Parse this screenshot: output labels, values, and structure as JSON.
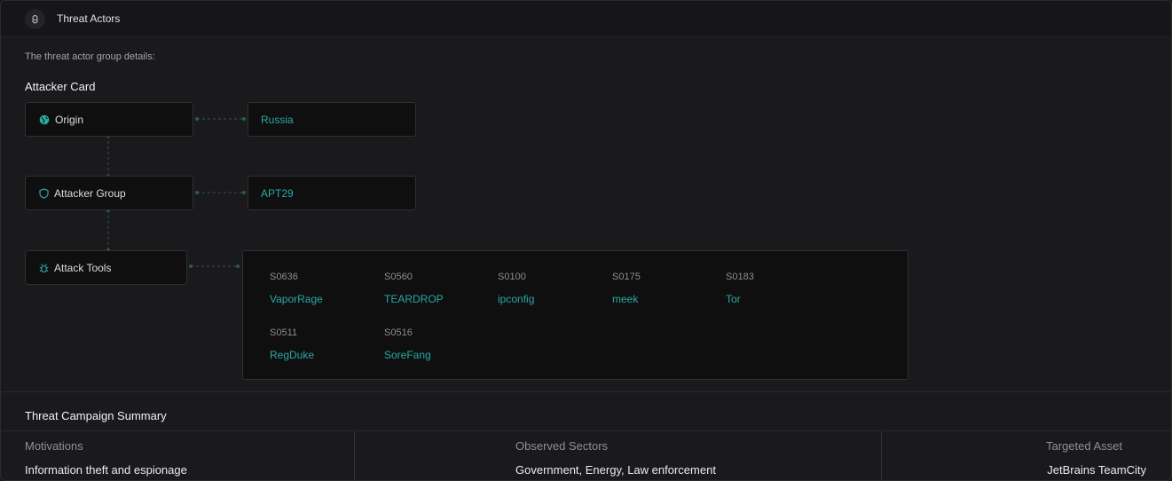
{
  "header": {
    "title": "Threat Actors",
    "icon": "user-shield-icon"
  },
  "description": "The threat actor group details:",
  "attacker_card": {
    "title": "Attacker Card",
    "origin": {
      "label": "Origin",
      "icon": "globe-icon",
      "value": "Russia"
    },
    "group": {
      "label": "Attacker Group",
      "icon": "shield-icon",
      "value": "APT29"
    },
    "tools": {
      "label": "Attack Tools",
      "icon": "bug-icon",
      "items": [
        {
          "id": "S0636",
          "name": "VaporRage"
        },
        {
          "id": "S0560",
          "name": "TEARDROP"
        },
        {
          "id": "S0100",
          "name": "ipconfig"
        },
        {
          "id": "S0175",
          "name": "meek"
        },
        {
          "id": "S0183",
          "name": "Tor"
        },
        {
          "id": "S0511",
          "name": "RegDuke"
        },
        {
          "id": "S0516",
          "name": "SoreFang"
        }
      ]
    }
  },
  "summary": {
    "title": "Threat Campaign Summary",
    "columns": [
      {
        "header": "Motivations",
        "value": "Information theft and espionage"
      },
      {
        "header": "Observed Sectors",
        "value": "Government, Energy, Law enforcement"
      },
      {
        "header": "Targeted Asset",
        "value": "JetBrains TeamCity"
      }
    ]
  },
  "colors": {
    "accent": "#2aa8a2",
    "background": "#1a1a1c",
    "box_background": "#0f0f10",
    "connector": "#2f5a4b"
  }
}
